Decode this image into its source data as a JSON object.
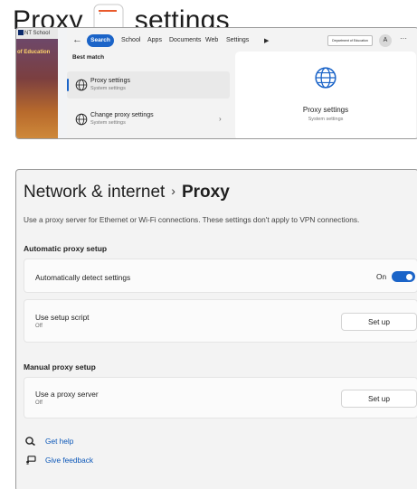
{
  "header": {
    "title_left": "Proxy",
    "title_right": "settings"
  },
  "search_panel": {
    "browser_tab": "NT School",
    "background_text": "of Education",
    "back_arrow": "←",
    "scopes": [
      "Search",
      "School",
      "Apps",
      "Documents",
      "Web",
      "Settings"
    ],
    "play_glyph": "▶",
    "org_badge": "Department of Education",
    "account_initial": "A",
    "more_glyph": "···",
    "best_match_label": "Best match",
    "results": [
      {
        "name": "Proxy settings",
        "subtitle": "System settings",
        "icon": "globe-icon"
      },
      {
        "name": "Change proxy settings",
        "subtitle": "System settings",
        "icon": "globe-icon"
      }
    ],
    "chevron_glyph": "›",
    "preview": {
      "name": "Proxy settings",
      "subtitle": "System settings",
      "icon": "globe-icon"
    }
  },
  "settings": {
    "breadcrumb_parent": "Network & internet",
    "breadcrumb_separator": "›",
    "breadcrumb_current": "Proxy",
    "description": "Use a proxy server for Ethernet or Wi-Fi connections. These settings don't apply to VPN connections.",
    "auto_section": "Automatic proxy setup",
    "detect_label": "Automatically detect settings",
    "detect_state": "On",
    "detect_value": true,
    "script_label": "Use setup script",
    "script_state": "Off",
    "script_button": "Set up",
    "manual_section": "Manual proxy setup",
    "proxy_label": "Use a proxy server",
    "proxy_state": "Off",
    "proxy_button": "Set up",
    "help_link": "Get help",
    "feedback_link": "Give feedback",
    "accent_color": "#1b64c8",
    "link_color": "#0b57b8"
  }
}
